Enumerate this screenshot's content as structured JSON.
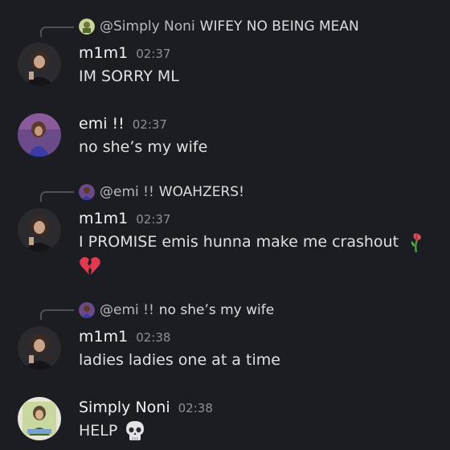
{
  "messages": [
    {
      "reply": {
        "user": "@Simply Noni",
        "text": "WIFEY NO BEING MEAN",
        "avatar_icon": "simply-noni-avatar-icon"
      },
      "author": "m1m1",
      "time": "02:37",
      "text": "IM SORRY ML"
    },
    {
      "author": "emi !!",
      "time": "02:37",
      "text": "no she’s my wife"
    },
    {
      "reply": {
        "user": "@emi !!",
        "text": "WOAHZERS!",
        "avatar_icon": "emi-avatar-icon"
      },
      "author": "m1m1",
      "time": "02:37",
      "text": "I PROMISE emis hunna make me crashout",
      "emojis": [
        "wilted-rose-icon",
        "broken-heart-icon"
      ]
    },
    {
      "reply": {
        "user": "@emi !!",
        "text": "no she’s my wife",
        "avatar_icon": "emi-avatar-icon"
      },
      "author": "m1m1",
      "time": "02:38",
      "text": "ladies ladies one at a time"
    },
    {
      "author": "Simply Noni",
      "time": "02:38",
      "text": "HELP",
      "emojis": [
        "skull-icon"
      ]
    }
  ],
  "colors": {
    "background": "#1c1d22",
    "username": "#f2f3f5",
    "timestamp": "#8e9098",
    "text": "#dfe0e4",
    "reply_line": "#4e5058"
  }
}
